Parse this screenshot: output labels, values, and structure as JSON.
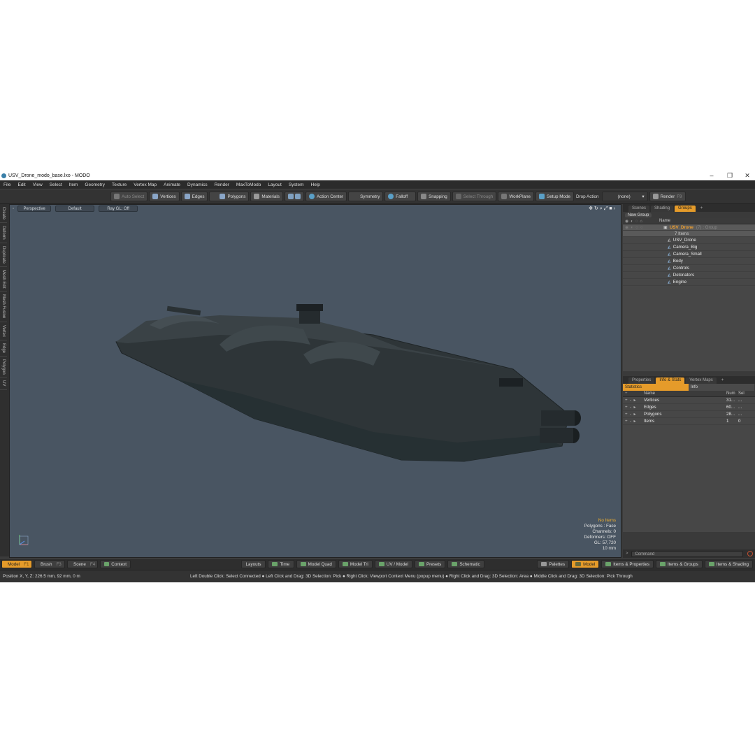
{
  "window": {
    "title": "USV_Drone_modo_base.lxo - MODO",
    "minimize": "–",
    "maximize": "❐",
    "close": "✕"
  },
  "menu": [
    "File",
    "Edit",
    "View",
    "Select",
    "Item",
    "Geometry",
    "Texture",
    "Vertex Map",
    "Animate",
    "Dynamics",
    "Render",
    "MaxToModo",
    "Layout",
    "System",
    "Help"
  ],
  "toolbar": {
    "auto_select": "Auto Select",
    "vertices": "Vertices",
    "edges": "Edges",
    "polygons": "Polygons",
    "materials": "Materials",
    "action_center": "Action Center",
    "symmetry": "Symmetry",
    "falloff": "Falloff",
    "snapping": "Snapping",
    "select_through": "Select Through",
    "workplane": "WorkPlane",
    "setup_mode": "Setup Mode",
    "drop_action_label": "Drop Action",
    "drop_action_value": "(none)",
    "render": "Render",
    "render_key": "F9"
  },
  "left_tabs": [
    "Create",
    "Deform",
    "Duplicate",
    "Mesh Edit",
    "Mesh Fusion",
    "Vertex",
    "Edge",
    "Polygon",
    "UV"
  ],
  "viewport": {
    "projection": "Perspective",
    "shading": "Default",
    "raygl": "Ray GL: Off",
    "info": {
      "items": "No Items",
      "polygons": "Polygons : Face",
      "channels": "Channels: 0",
      "deformers": "Deformers: OFF",
      "gl": "GL: 57,720",
      "scale": "10 mm"
    }
  },
  "groups_panel": {
    "tabs": [
      "Scenes",
      "Shading",
      "Groups",
      "+"
    ],
    "new_group": "New Group",
    "name_header": "Name",
    "root": {
      "name": "USV_Drone",
      "count": "(7) : Group",
      "sub": "7 Items"
    },
    "items": [
      "USV_Drone",
      "Camera_Big",
      "Camera_Small",
      "Body",
      "Controls",
      "Detonators",
      "Engine"
    ]
  },
  "stats_panel": {
    "tabs": [
      "Properties",
      "Info & Stats",
      "Vertex Maps",
      "+"
    ],
    "subtabs": [
      "Statistics",
      "Info"
    ],
    "headers": {
      "name": "Name",
      "num": "Num",
      "sel": "Sel"
    },
    "rows": [
      {
        "name": "Vertices",
        "num": "31...",
        "sel": "..."
      },
      {
        "name": "Edges",
        "num": "60...",
        "sel": "..."
      },
      {
        "name": "Polygons",
        "num": "28...",
        "sel": "..."
      },
      {
        "name": "Items",
        "num": "1",
        "sel": "0"
      }
    ],
    "command_placeholder": "Command"
  },
  "bottom": {
    "model": "Model",
    "model_key": "F1",
    "brush": "Brush",
    "brush_key": "F3",
    "scene": "Scene",
    "scene_key": "F4",
    "context": "Context",
    "layouts": "Layouts",
    "time": "Time",
    "model_quad": "Model Quad",
    "model_tri": "Model Tri",
    "uv_model": "UV / Model",
    "presets": "Presets",
    "schematic": "Schematic",
    "palettes": "Palettes",
    "model_right": "Model",
    "items_properties": "Items & Properties",
    "items_groups": "Items & Groups",
    "items_shading": "Items & Shading"
  },
  "status": {
    "position": "Position X, Y, Z:   226.5 mm, 92 mm, 0 m",
    "hints": "Left Double Click: Select Connected ● Left Click and Drag: 3D Selection: Pick ● Right Click: Viewport Context Menu (popup menu) ● Right Click and Drag: 3D Selection: Area ● Middle Click and Drag: 3D Selection: Pick Through"
  },
  "colors": {
    "accent": "#e59b2a",
    "viewport_bg": "#495562",
    "hull": "#2e3538"
  }
}
